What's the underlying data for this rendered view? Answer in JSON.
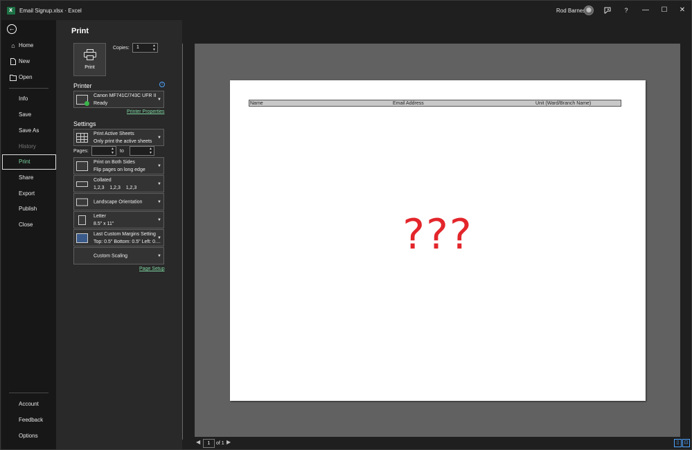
{
  "titlebar": {
    "title": "Email Signup.xlsx  ·  Excel",
    "user": "Rod Barnes",
    "help": "?",
    "minimize": "—",
    "maximize": "☐",
    "close": "✕"
  },
  "nav": {
    "items": [
      {
        "label": "Home",
        "icon": "home-icon"
      },
      {
        "label": "New",
        "icon": "new-file-icon"
      },
      {
        "label": "Open",
        "icon": "folder-open-icon"
      }
    ],
    "plain_items": [
      {
        "label": "Info"
      },
      {
        "label": "Save"
      },
      {
        "label": "Save As"
      },
      {
        "label": "History"
      },
      {
        "label": "Print"
      },
      {
        "label": "Share"
      },
      {
        "label": "Export"
      },
      {
        "label": "Publish"
      },
      {
        "label": "Close"
      }
    ],
    "bottom_items": [
      {
        "label": "Account"
      },
      {
        "label": "Feedback"
      },
      {
        "label": "Options"
      }
    ]
  },
  "print_panel": {
    "title": "Print",
    "print_button_label": "Print",
    "copies_label": "Copies:",
    "copies_value": "1",
    "printer_heading": "Printer",
    "printer_name": "Canon MF741C/743C UFR II",
    "printer_status": "Ready",
    "printer_properties_link": "Printer Properties",
    "settings_heading": "Settings",
    "what_to_print": {
      "line1": "Print Active Sheets",
      "line2": "Only print the active sheets"
    },
    "pages_label": "Pages:",
    "pages_to_label": "to",
    "duplex": {
      "line1": "Print on Both Sides",
      "line2": "Flip pages on long edge"
    },
    "collation": {
      "line1": "Collated",
      "line2": "1,2,3    1,2,3    1,2,3"
    },
    "orientation": "Landscape Orientation",
    "paper": {
      "line1": "Letter",
      "line2": "8.5\" x 11\""
    },
    "margins": {
      "line1": "Last Custom Margins Setting",
      "line2": "Top: 0.5\" Bottom: 0.5\" Left: 0...."
    },
    "scaling": "Custom Scaling",
    "page_setup_link": "Page Setup"
  },
  "preview": {
    "columns": [
      "Name",
      "Email Address",
      "Unit (Ward/Branch Name)"
    ],
    "overlay_text": "???"
  },
  "pager": {
    "current_page": "1",
    "of_label": "of 1"
  },
  "colors": {
    "accent_green": "#7dd5a0",
    "link_blue": "#4da3ff",
    "overlay_red": "#e3262b"
  }
}
